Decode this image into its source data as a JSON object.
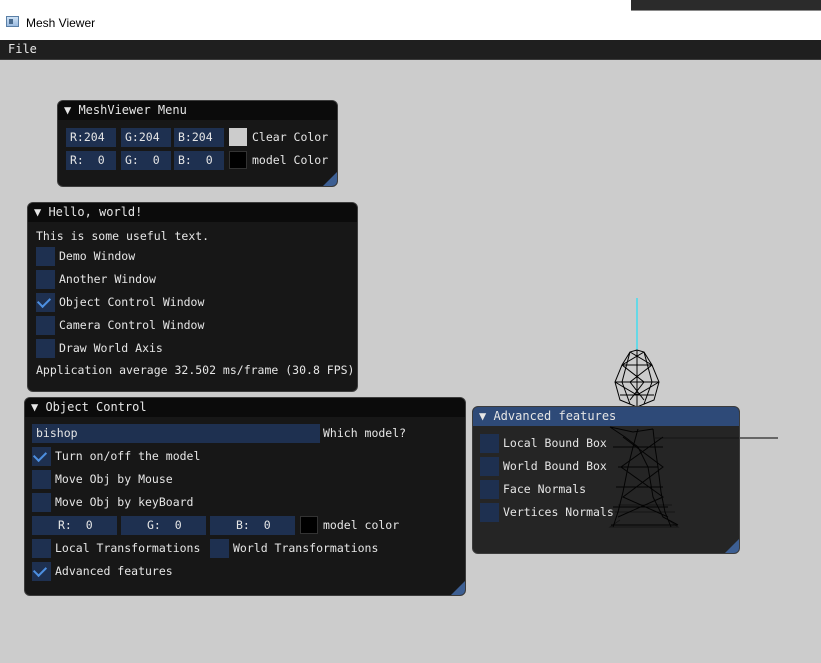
{
  "window": {
    "title": "Mesh Viewer",
    "icon": "app-window-icon"
  },
  "menubar": {
    "file_label": "File"
  },
  "meshviewer_menu": {
    "title": "MeshViewer Menu",
    "clear_color": {
      "r": "R:204",
      "g": "G:204",
      "b": "B:204",
      "label": "Clear Color",
      "swatch": "#cccccc"
    },
    "model_color": {
      "r": "R:  0",
      "g": "G:  0",
      "b": "B:  0",
      "label": "model Color",
      "swatch": "#000000"
    }
  },
  "hello_world": {
    "title": "Hello, world!",
    "text": "This is some useful text.",
    "checkboxes": [
      {
        "label": "Demo Window",
        "checked": false
      },
      {
        "label": "Another Window",
        "checked": false
      },
      {
        "label": "Object Control Window",
        "checked": true
      },
      {
        "label": "Camera Control Window",
        "checked": false
      },
      {
        "label": "Draw World Axis",
        "checked": false
      }
    ],
    "status": "Application average 32.502 ms/frame (30.8 FPS)"
  },
  "object_control": {
    "title": "Object Control",
    "model_input": "bishop",
    "model_label": "Which model?",
    "turn_on_off": {
      "label": "Turn on/off the model",
      "checked": true
    },
    "move_mouse": {
      "label": "Move Obj by Mouse",
      "checked": false
    },
    "move_keyboard": {
      "label": "Move Obj by keyBoard",
      "checked": false
    },
    "color": {
      "r": "R:  0",
      "g": "G:  0",
      "b": "B:  0",
      "label": "model color",
      "swatch": "#000000"
    },
    "local_transform": {
      "label": "Local Transformations",
      "checked": false
    },
    "world_transform": {
      "label": "World Transformations",
      "checked": false
    },
    "advanced": {
      "label": "Advanced features",
      "checked": true
    }
  },
  "advanced_features": {
    "title": "Advanced features",
    "checkboxes": [
      {
        "label": "Local Bound Box",
        "checked": false
      },
      {
        "label": "World Bound Box",
        "checked": false
      },
      {
        "label": "Face Normals",
        "checked": false
      },
      {
        "label": "Vertices Normals",
        "checked": false
      }
    ]
  },
  "colors": {
    "background": "#cccccc",
    "window_bg": "#171717",
    "frame_bg": "#1e3050",
    "check": "#4d8fe0",
    "active_title": "#2e4a78",
    "axis": "#00e5ff"
  }
}
